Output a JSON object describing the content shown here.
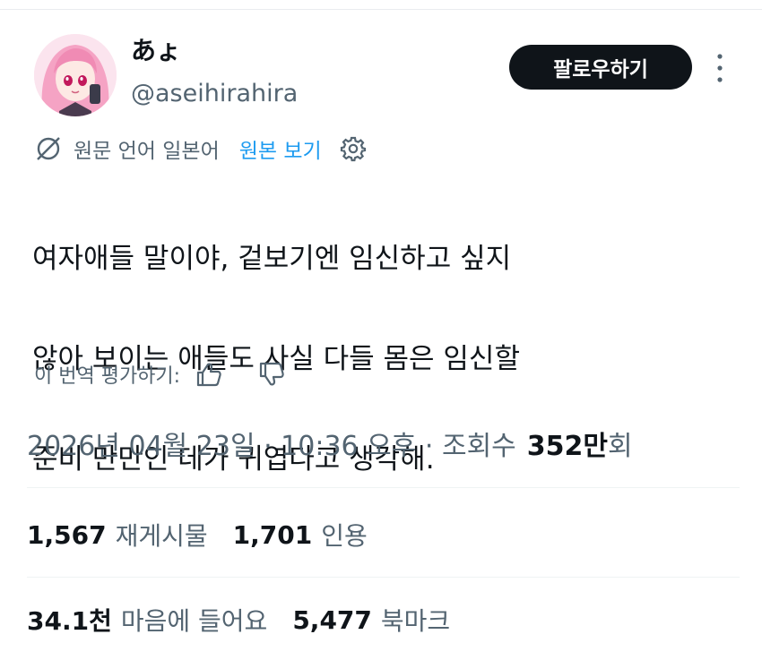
{
  "user": {
    "display_name": "あょ",
    "handle": "@aseihirahira"
  },
  "header": {
    "follow_label": "팔로우하기"
  },
  "translation": {
    "source_text": "원문 언어 일본어",
    "show_original_label": "원본 보기"
  },
  "tweet": {
    "lines": [
      "여자애들 말이야, 겉보기엔 임신하고 싶지",
      "않아 보이는 애들도 사실 다들 몸은 임신할",
      "준비 만만인 데가 귀엽다고 생각해."
    ]
  },
  "rating": {
    "label": "이 번역 평가하기:"
  },
  "meta": {
    "timestamp": "2026년 04월 23일 · 10:36 오후 · 조회수",
    "views_value": "352만",
    "views_suffix": "회"
  },
  "stats": {
    "reposts_count": "1,567",
    "reposts_label": "재게시물",
    "quotes_count": "1,701",
    "quotes_label": "인용",
    "likes_count": "34.1천",
    "likes_label": "마음에 들어요",
    "bookmarks_count": "5,477",
    "bookmarks_label": "북마크"
  },
  "colors": {
    "text_primary": "#0f1419",
    "text_secondary": "#536471",
    "link": "#1d9bf0",
    "button_bg": "#0f1419"
  },
  "icons": {
    "translate": "translate-icon",
    "settings": "gear-icon",
    "more": "more-vertical-icon",
    "like_rating": "thumbs-up-icon",
    "dislike_rating": "thumbs-down-icon"
  }
}
